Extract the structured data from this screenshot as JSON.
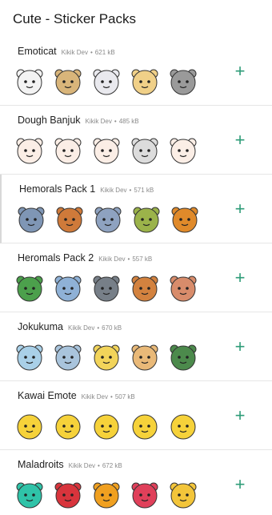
{
  "app": {
    "title": "Cute - Sticker Packs"
  },
  "packs": [
    {
      "name": "Emoticat",
      "author": "Kikik Dev",
      "separator": "•",
      "size": "621 kB",
      "stickers": [
        "cat-sticker",
        "puppy-sticker",
        "cat-sticker",
        "cat-sticker",
        "cat-sticker"
      ],
      "add_label": "+",
      "colors": [
        "#f3f3f3",
        "#d9b57a",
        "#e9e9ee",
        "#f0d088",
        "#9a9a9a"
      ]
    },
    {
      "name": "Dough Banjuk",
      "author": "Kikik Dev",
      "separator": "•",
      "size": "485 kB",
      "stickers": [
        "dough-sticker",
        "dough-sticker",
        "dough-sticker",
        "dough-sticker",
        "dough-sticker"
      ],
      "add_label": "+",
      "colors": [
        "#fbeee6",
        "#fbeee6",
        "#fbeee6",
        "#dcdcdc",
        "#fbeee6"
      ]
    },
    {
      "name": "Hemorals Pack 1",
      "author": "Kikik Dev",
      "separator": "•",
      "size": "571 kB",
      "stickers": [
        "animal-sticker",
        "animal-sticker",
        "animal-sticker",
        "animal-sticker",
        "animal-sticker"
      ],
      "add_label": "+",
      "colors": [
        "#7f96b5",
        "#cf7a3a",
        "#8ea2c0",
        "#9bb34a",
        "#e08a2a"
      ]
    },
    {
      "name": "Heromals Pack 2",
      "author": "Kikik Dev",
      "separator": "•",
      "size": "557 kB",
      "stickers": [
        "animal-sticker",
        "animal-sticker",
        "animal-sticker",
        "animal-sticker",
        "animal-sticker"
      ],
      "add_label": "+",
      "colors": [
        "#4ca04c",
        "#8fb1d6",
        "#777f88",
        "#d3823f",
        "#d88c6b"
      ]
    },
    {
      "name": "Jokukuma",
      "author": "Kikik Dev",
      "separator": "•",
      "size": "670 kB",
      "stickers": [
        "bear-sticker",
        "bear-sticker",
        "bear-sticker",
        "bear-sticker",
        "bear-sticker"
      ],
      "add_label": "+",
      "colors": [
        "#a9d0e8",
        "#a9c4dc",
        "#f2d45a",
        "#e9b978",
        "#4c8a4c"
      ]
    },
    {
      "name": "Kawai Emote",
      "author": "Kikik Dev",
      "separator": "•",
      "size": "507 kB",
      "stickers": [
        "emoji-sticker",
        "emoji-sticker",
        "emoji-sticker",
        "emoji-sticker",
        "emoji-sticker"
      ],
      "add_label": "+",
      "colors": [
        "#f6d23a",
        "#f6d23a",
        "#f6d23a",
        "#f6d23a",
        "#f6d23a"
      ]
    },
    {
      "name": "Maladroits",
      "author": "Kikik Dev",
      "separator": "•",
      "size": "672 kB",
      "stickers": [
        "monster-sticker",
        "monster-sticker",
        "monster-sticker",
        "monster-sticker",
        "monster-sticker"
      ],
      "add_label": "+",
      "colors": [
        "#2fc3a8",
        "#d8343c",
        "#f0a020",
        "#e0405a",
        "#f3c53a"
      ]
    }
  ],
  "accent_color": "#2e9c78"
}
